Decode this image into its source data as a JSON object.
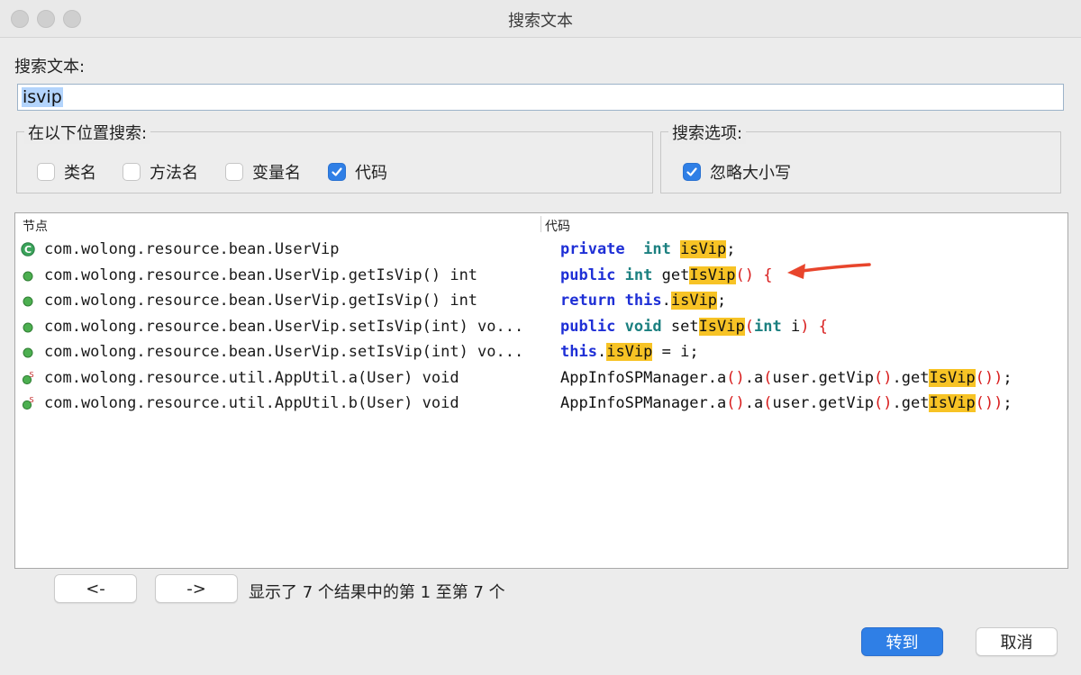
{
  "window": {
    "title": "搜索文本"
  },
  "search": {
    "label": "搜索文本:",
    "value": "isvip"
  },
  "location_group": {
    "legend": "在以下位置搜索:",
    "options": [
      {
        "label": "类名",
        "checked": false
      },
      {
        "label": "方法名",
        "checked": false
      },
      {
        "label": "变量名",
        "checked": false
      },
      {
        "label": "代码",
        "checked": true
      }
    ]
  },
  "options_group": {
    "legend": "搜索选项:",
    "options": [
      {
        "label": "忽略大小写",
        "checked": true
      }
    ]
  },
  "results": {
    "headers": {
      "node": "节点",
      "code": "代码"
    },
    "rows": [
      {
        "icon": "class-icon",
        "node": "com.wolong.resource.bean.UserVip",
        "code": [
          [
            "kw",
            "private"
          ],
          [
            "",
            "  "
          ],
          [
            "ty",
            "int"
          ],
          [
            "",
            ""
          ],
          [
            "hl",
            "isVip"
          ],
          [
            "",
            ";"
          ]
        ]
      },
      {
        "icon": "method-icon",
        "node": "com.wolong.resource.bean.UserVip.getIsVip() int",
        "code": [
          [
            "kw",
            "public"
          ],
          [
            "",
            ""
          ],
          [
            "ty",
            "int"
          ],
          [
            "",
            "get"
          ],
          [
            "hl",
            "IsVip"
          ],
          [
            "pr",
            "() {"
          ]
        ]
      },
      {
        "icon": "method-icon",
        "node": "com.wolong.resource.bean.UserVip.getIsVip() int",
        "code": [
          [
            "kw",
            "return"
          ],
          [
            "",
            ""
          ],
          [
            "kw",
            "this"
          ],
          [
            "",
            "."
          ],
          [
            "hl",
            "isVip"
          ],
          [
            "",
            ";"
          ]
        ]
      },
      {
        "icon": "method-icon",
        "node": "com.wolong.resource.bean.UserVip.setIsVip(int) vo...",
        "code": [
          [
            "kw",
            "public"
          ],
          [
            "",
            ""
          ],
          [
            "ty",
            "void"
          ],
          [
            "",
            "set"
          ],
          [
            "hl",
            "IsVip"
          ],
          [
            "pr",
            "("
          ],
          [
            "ty",
            "int"
          ],
          [
            "",
            " i"
          ],
          [
            "pr",
            ") {"
          ]
        ]
      },
      {
        "icon": "method-icon",
        "node": "com.wolong.resource.bean.UserVip.setIsVip(int) vo...",
        "code": [
          [
            "kw",
            "this"
          ],
          [
            "",
            "."
          ],
          [
            "hl",
            "isVip"
          ],
          [
            "",
            " = i;"
          ]
        ]
      },
      {
        "icon": "static-method-icon",
        "node": "com.wolong.resource.util.AppUtil.a(User) void",
        "code": [
          [
            "",
            "AppInfoSPManager.a"
          ],
          [
            "pr",
            "()"
          ],
          [
            "",
            ".a"
          ],
          [
            "pr",
            "("
          ],
          [
            "",
            "user.getVip"
          ],
          [
            "pr",
            "()"
          ],
          [
            "",
            ".get"
          ],
          [
            "hl",
            "IsVip"
          ],
          [
            "pr",
            "())"
          ],
          [
            "",
            ";"
          ]
        ]
      },
      {
        "icon": "static-method-icon",
        "node": "com.wolong.resource.util.AppUtil.b(User) void",
        "code": [
          [
            "",
            "AppInfoSPManager.a"
          ],
          [
            "pr",
            "()"
          ],
          [
            "",
            ".a"
          ],
          [
            "pr",
            "("
          ],
          [
            "",
            "user.getVip"
          ],
          [
            "pr",
            "()"
          ],
          [
            "",
            ".get"
          ],
          [
            "hl",
            "IsVip"
          ],
          [
            "pr",
            "())"
          ],
          [
            "",
            ";"
          ]
        ]
      }
    ]
  },
  "nav": {
    "prev_label": "<-",
    "next_label": "->",
    "status": "显示了 7 个结果中的第 1 至第 7 个"
  },
  "footer": {
    "goto_label": "转到",
    "cancel_label": "取消"
  },
  "colors": {
    "accent": "#2f7fe6",
    "highlight": "#f7c325",
    "keyword": "#1e2fd6",
    "type": "#1b8080",
    "paren": "#d81b1b",
    "arrow": "#e8452c"
  }
}
